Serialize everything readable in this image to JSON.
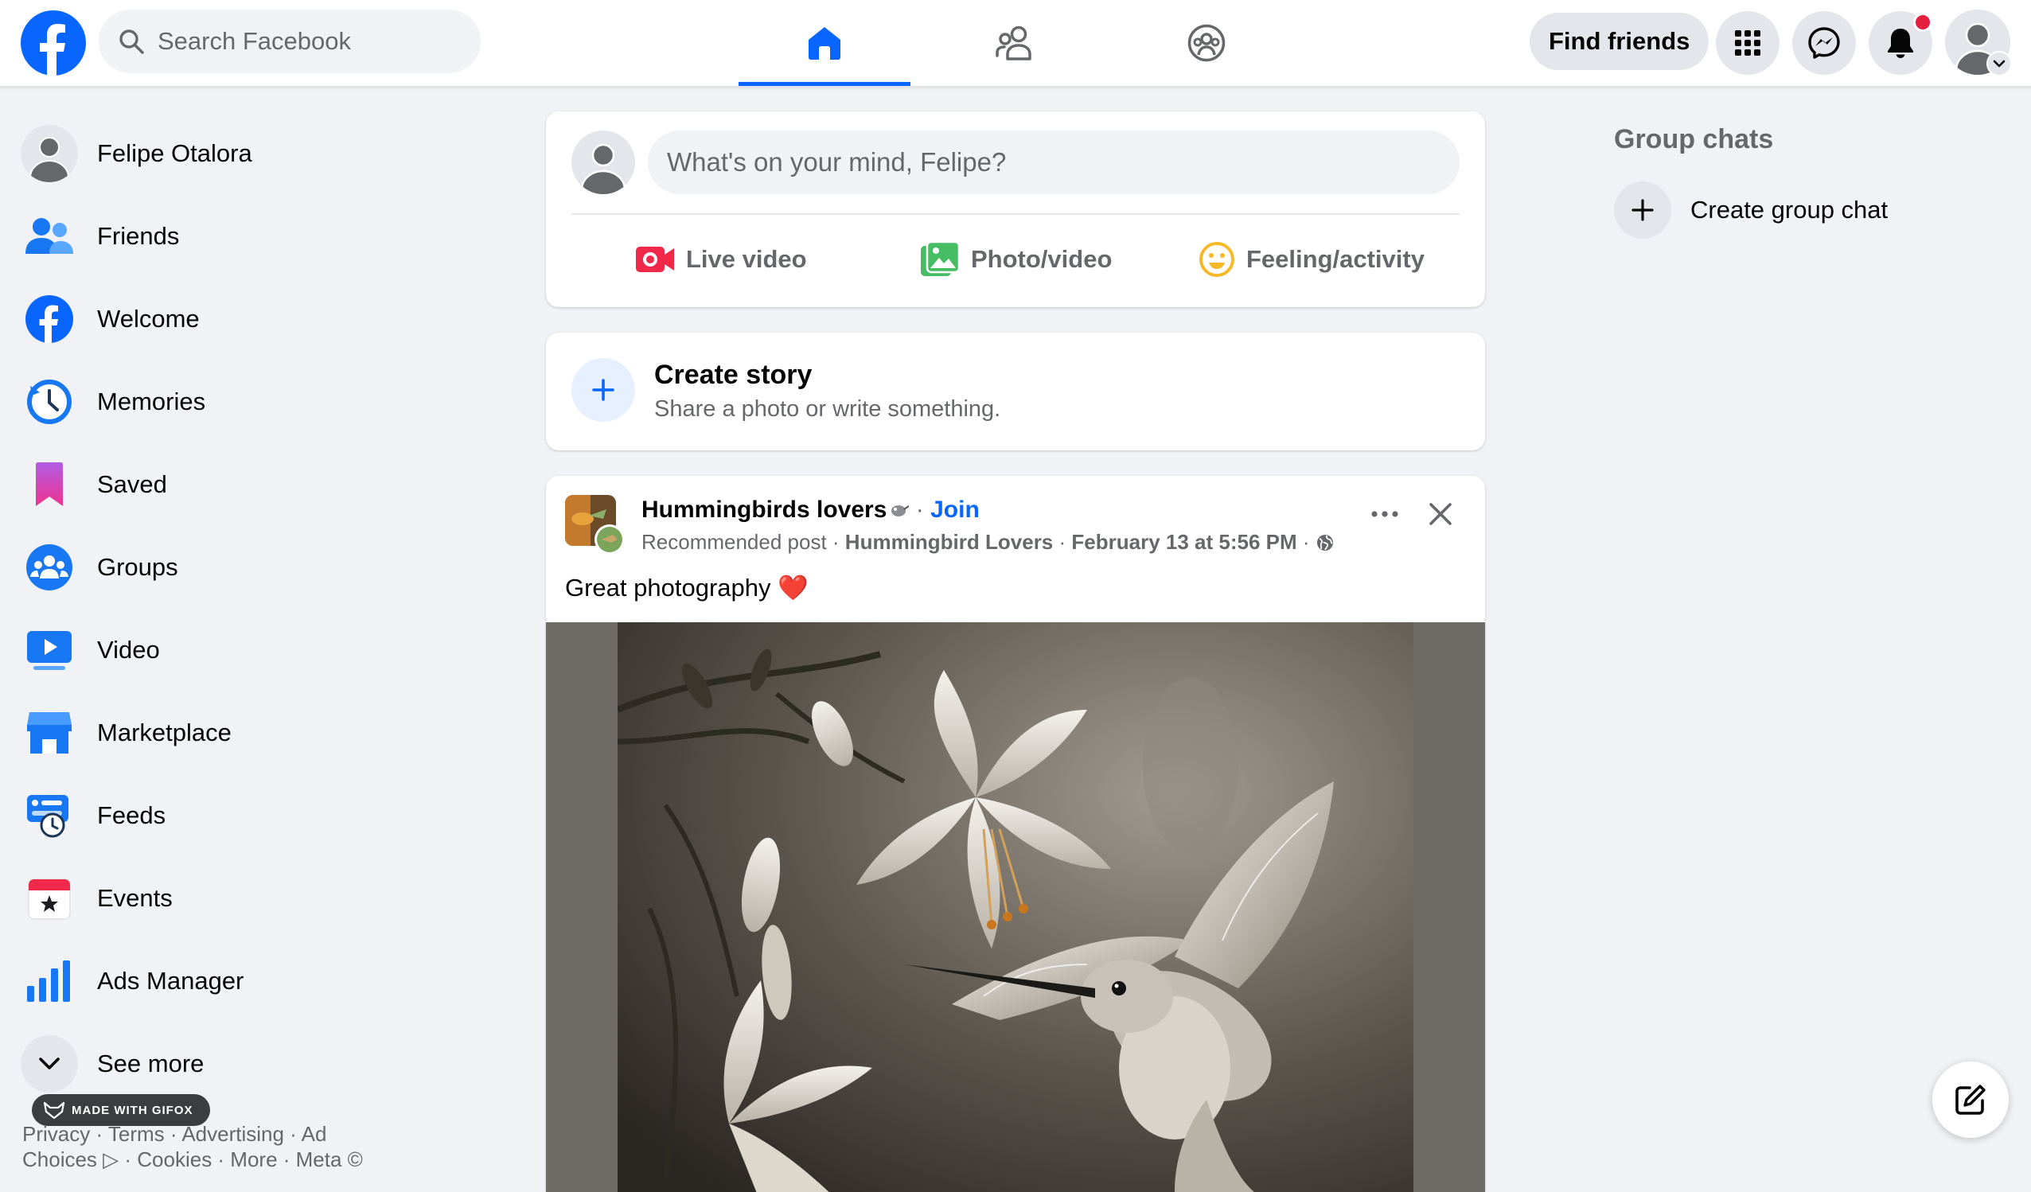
{
  "header": {
    "search_placeholder": "Search Facebook",
    "find_friends_label": "Find friends",
    "active_tab": "home",
    "notification_dot": true
  },
  "user": {
    "name": "Felipe Otalora"
  },
  "sidebar": {
    "items": [
      {
        "label": "Felipe Otalora",
        "icon": "profile-avatar-icon"
      },
      {
        "label": "Friends",
        "icon": "friends-icon"
      },
      {
        "label": "Welcome",
        "icon": "facebook-logo-icon"
      },
      {
        "label": "Memories",
        "icon": "memories-clock-icon"
      },
      {
        "label": "Saved",
        "icon": "saved-bookmark-icon"
      },
      {
        "label": "Groups",
        "icon": "groups-icon"
      },
      {
        "label": "Video",
        "icon": "video-icon"
      },
      {
        "label": "Marketplace",
        "icon": "marketplace-icon"
      },
      {
        "label": "Feeds",
        "icon": "feeds-icon"
      },
      {
        "label": "Events",
        "icon": "events-icon"
      },
      {
        "label": "Ads Manager",
        "icon": "ads-manager-icon"
      },
      {
        "label": "See more",
        "icon": "chevron-down-icon"
      }
    ],
    "footer_line1": "Privacy · Terms · Advertising · Ad",
    "footer_line2": "Choices ▷ · Cookies · More · Meta ©",
    "watermark": "MADE WITH GIFOX"
  },
  "composer": {
    "placeholder": "What's on your mind, Felipe?",
    "actions": [
      {
        "label": "Live video",
        "icon": "live-video-icon"
      },
      {
        "label": "Photo/video",
        "icon": "photo-video-icon"
      },
      {
        "label": "Feeling/activity",
        "icon": "feeling-icon"
      }
    ]
  },
  "story": {
    "title": "Create story",
    "subtitle": "Share a photo or write something."
  },
  "post": {
    "group_name": "Hummingbirds lovers",
    "join_label": "Join",
    "recommended": "Recommended post",
    "author": "Hummingbird Lovers",
    "timestamp": "February 13 at 5:56 PM",
    "text": "Great photography ❤️"
  },
  "right": {
    "group_chats_title": "Group chats",
    "create_group_chat": "Create group chat"
  },
  "colors": {
    "brand_blue": "#0866ff",
    "page_bg": "#f0f2f5",
    "secondary_text": "#65676b"
  }
}
